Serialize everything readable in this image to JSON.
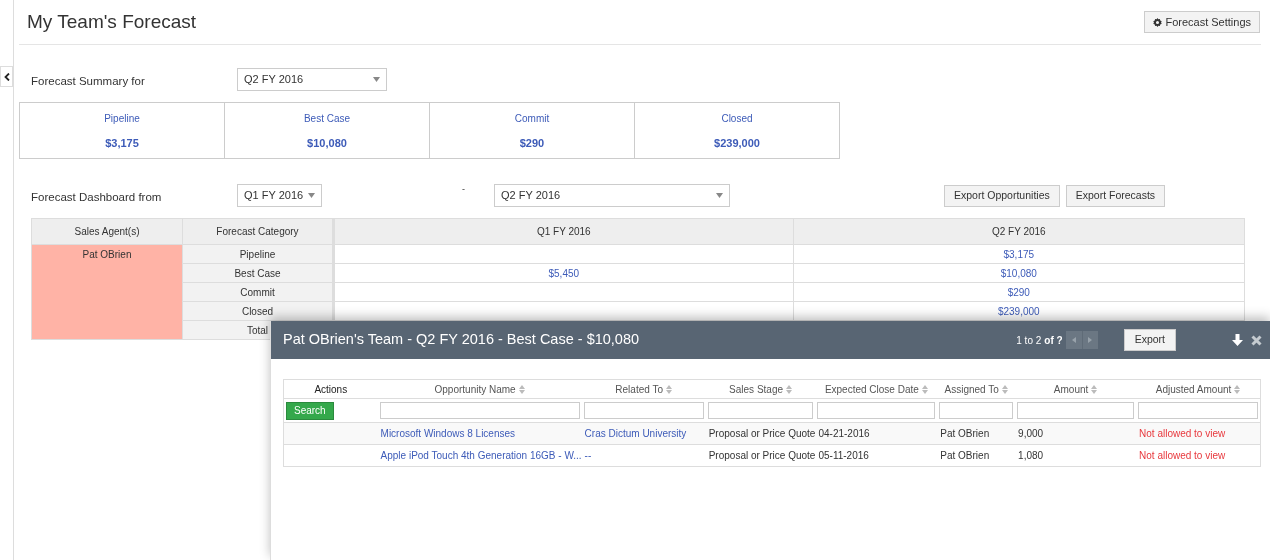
{
  "header": {
    "title": "My Team's Forecast",
    "settings_button": "Forecast Settings"
  },
  "summary": {
    "label": "Forecast Summary for",
    "period": "Q2 FY 2016",
    "cards": [
      {
        "label": "Pipeline",
        "value": "$3,175"
      },
      {
        "label": "Best Case",
        "value": "$10,080"
      },
      {
        "label": "Commit",
        "value": "$290"
      },
      {
        "label": "Closed",
        "value": "$239,000"
      }
    ]
  },
  "dashboard": {
    "label": "Forecast Dashboard from",
    "from": "Q1 FY 2016",
    "separator": "-",
    "to": "Q2 FY 2016",
    "buttons": [
      "Export Opportunities",
      "Export Forecasts"
    ],
    "table": {
      "columns": [
        "Sales Agent(s)",
        "Forecast Category",
        "Q1 FY 2016",
        "Q2 FY 2016"
      ],
      "agent": "Pat OBrien",
      "rows": [
        {
          "category": "Pipeline",
          "column_4": "$3,175"
        },
        {
          "category": "Best Case",
          "column_3": "$5,450",
          "column_4": "$10,080"
        },
        {
          "category": "Commit",
          "column_4": "$290"
        },
        {
          "category": "Closed",
          "column_4": "$239,000"
        },
        {
          "category": "Total"
        }
      ]
    }
  },
  "popup": {
    "title": "Pat OBrien's Team - Q2 FY 2016 - Best Case - $10,080",
    "pager": "1 to 2",
    "pager_of": "of ?",
    "export_button": "Export",
    "search_button": "Search",
    "columns": [
      {
        "label": "Actions",
        "sortable": false
      },
      {
        "label": "Opportunity Name",
        "sortable": true
      },
      {
        "label": "Related To",
        "sortable": true
      },
      {
        "label": "Sales Stage",
        "sortable": true
      },
      {
        "label": "Expected Close Date",
        "sortable": true
      },
      {
        "label": "Assigned To",
        "sortable": true
      },
      {
        "label": "Amount",
        "sortable": true
      },
      {
        "label": "Adjusted Amount",
        "sortable": true
      }
    ],
    "rows": [
      {
        "name": "Microsoft Windows 8 Licenses",
        "related_to": "Cras Dictum University",
        "stage": "Proposal or Price Quote",
        "close_date": "04-21-2016",
        "assigned_to": "Pat OBrien",
        "amount": "9,000",
        "adjusted_amount": "Not allowed to view"
      },
      {
        "name": "Apple iPod Touch 4th Generation 16GB - W...",
        "related_to": "--",
        "stage": "Proposal or Price Quote",
        "close_date": "05-11-2016",
        "assigned_to": "Pat OBrien",
        "amount": "1,080",
        "adjusted_amount": "Not allowed to view"
      }
    ]
  }
}
